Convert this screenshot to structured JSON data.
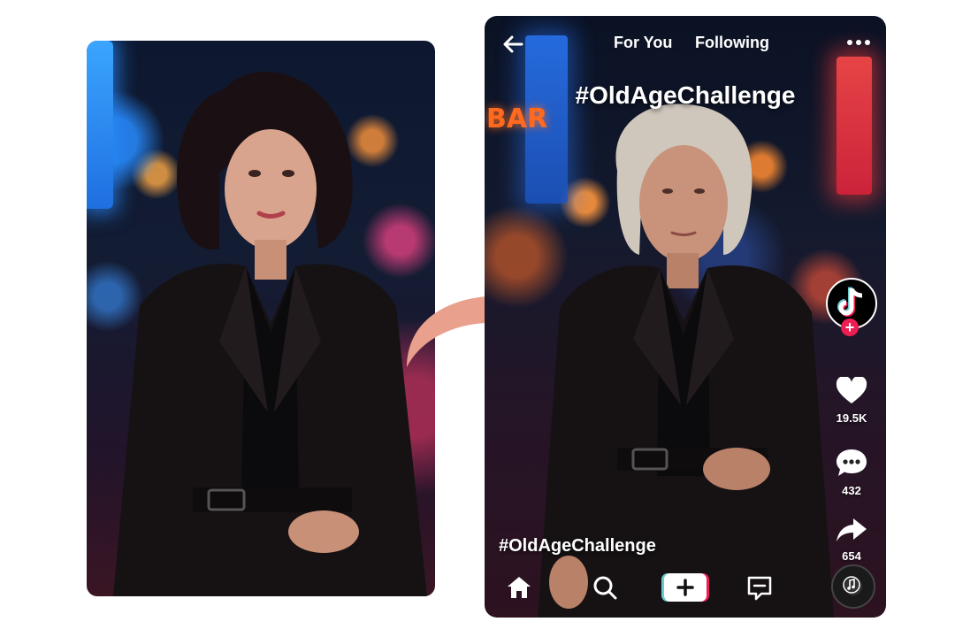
{
  "phone": {
    "top_nav": {
      "for_you_label": "For You",
      "following_label": "Following"
    },
    "overlay_hashtag": "#OldAgeChallenge",
    "neon_sign_text": "BAR",
    "actions": {
      "likes": "19.5K",
      "comments": "432",
      "shares": "654"
    },
    "caption": "#OldAgeChallenge"
  },
  "colors": {
    "arrow": "#e9a08d",
    "accent_red": "#ee1d52",
    "accent_cyan": "#69c9d0"
  },
  "icons": [
    "back-arrow-icon",
    "more-icon",
    "tiktok-logo-icon",
    "plus-icon",
    "heart-icon",
    "comment-icon",
    "share-icon",
    "home-icon",
    "search-icon",
    "create-icon",
    "inbox-icon",
    "music-note-icon"
  ]
}
